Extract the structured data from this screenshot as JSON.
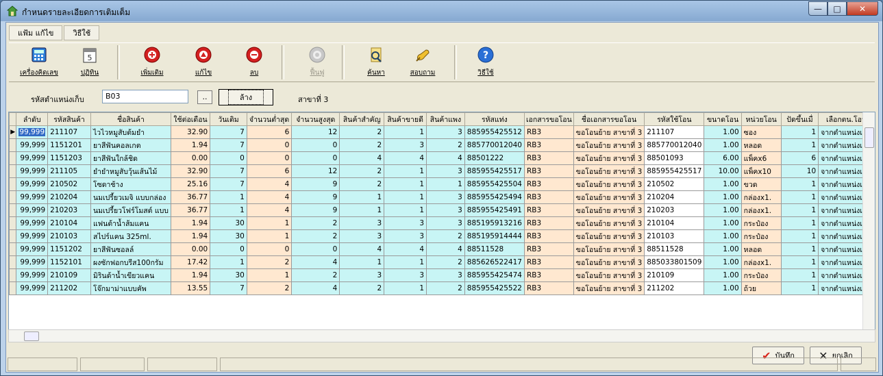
{
  "window": {
    "title": "กำหนดรายละเอียดการเติมเต็ม",
    "minimize_glyph": "—",
    "maximize_glyph": "□",
    "close_glyph": "✕"
  },
  "menu": [
    "แฟ้ม  แก้ไข",
    "วิธีใช้"
  ],
  "toolbar": [
    {
      "label": "เครื่องคิดเลข",
      "icon": "calculator-icon",
      "enabled": true
    },
    {
      "label": "ปฏิทิน",
      "icon": "calendar-icon",
      "enabled": true
    },
    {
      "label": "เพิ่มเติม",
      "icon": "add-icon",
      "enabled": true
    },
    {
      "label": "แก้ไข",
      "icon": "edit-icon",
      "enabled": true
    },
    {
      "label": "ลบ",
      "icon": "delete-icon",
      "enabled": true
    },
    {
      "label": "ฟื้นฟู",
      "icon": "restore-icon",
      "enabled": false
    },
    {
      "label": "ค้นหา",
      "icon": "search-icon",
      "enabled": true
    },
    {
      "label": "สอบถาม",
      "icon": "inquiry-icon",
      "enabled": true
    },
    {
      "label": "วิธีใช้",
      "icon": "help-icon",
      "enabled": true
    }
  ],
  "filter": {
    "label": "รหัสตำแหน่งเก็บ",
    "value": "B03",
    "browse": "..",
    "clear": "ล้าง",
    "branch": "สาขาที่ 3"
  },
  "grid": {
    "columns": [
      "ลำดับ",
      "รหัสสินค้า",
      "ชื่อสินค้า",
      "ใช้ต่อเดือน",
      "วันเติม",
      "จำนวนต่ำสุด",
      "จำนวนสูงสุด",
      "สินค้าสำคัญ",
      "สินค้าขายดี",
      "สินค้าแพง",
      "รหัสแท่ง",
      "เอกสารขอโอน",
      "ชื่อเอกสารขอโอน",
      "รหัสใช้โอน",
      "ขนาดโอน",
      "หน่วยโอน",
      "ปัดขึ้นเมื่",
      "เลือกตน.โอน"
    ],
    "rows": [
      [
        "99,999",
        "211107",
        "ไวไวหมูสับต้มยำ",
        "32.90",
        "7",
        "6",
        "12",
        "2",
        "1",
        "3",
        "885955425512",
        "RB3",
        "ขอโอนย้าย สาขาที่ 3",
        "211107",
        "1.00",
        "ซอง",
        "1",
        "จากตำแหน่งเก็บ"
      ],
      [
        "99,999",
        "1151201",
        "ยาสีฟันคอลเกต",
        "1.94",
        "7",
        "0",
        "0",
        "2",
        "3",
        "2",
        "885770012040",
        "RB3",
        "ขอโอนย้าย สาขาที่ 3",
        "885770012040",
        "1.00",
        "หลอด",
        "1",
        "จากตำแหน่งเก็บ"
      ],
      [
        "99,999",
        "1151203",
        "ยาสีฟันใกล้ชิด",
        "0.00",
        "0",
        "0",
        "0",
        "4",
        "4",
        "4",
        "88501222",
        "RB3",
        "ขอโอนย้าย สาขาที่ 3",
        "88501093",
        "6.00",
        "แพ็คx6",
        "6",
        "จากตำแหน่งเก็บ"
      ],
      [
        "99,999",
        "211105",
        "ยำยำหมูสับวุ้นเส้นไม้",
        "32.90",
        "7",
        "6",
        "12",
        "2",
        "1",
        "3",
        "885955425517",
        "RB3",
        "ขอโอนย้าย สาขาที่ 3",
        "885955425517",
        "10.00",
        "แพ็คx10",
        "10",
        "จากตำแหน่งเก็บ"
      ],
      [
        "99,999",
        "210502",
        "โซดาช้าง",
        "25.16",
        "7",
        "4",
        "9",
        "2",
        "1",
        "1",
        "885955425504",
        "RB3",
        "ขอโอนย้าย สาขาที่ 3",
        "210502",
        "1.00",
        "ขวด",
        "1",
        "จากตำแหน่งเก็บ"
      ],
      [
        "99,999",
        "210204",
        "นมเปรี้ยวเมจิ แบบกล่อง",
        "36.77",
        "1",
        "4",
        "9",
        "1",
        "1",
        "3",
        "885955425494",
        "RB3",
        "ขอโอนย้าย สาขาที่ 3",
        "210204",
        "1.00",
        "กล่องx1.",
        "1",
        "จากตำแหน่งเก็บ"
      ],
      [
        "99,999",
        "210203",
        "นมเปรี้ยวโฟร์โมสต์ แบบ",
        "36.77",
        "1",
        "4",
        "9",
        "1",
        "1",
        "3",
        "885955425491",
        "RB3",
        "ขอโอนย้าย สาขาที่ 3",
        "210203",
        "1.00",
        "กล่องx1.",
        "1",
        "จากตำแหน่งเก็บ"
      ],
      [
        "99,999",
        "210104",
        "แฟนต้าน้ำส้มแคน",
        "1.94",
        "30",
        "1",
        "2",
        "3",
        "3",
        "3",
        "885195913216",
        "RB3",
        "ขอโอนย้าย สาขาที่ 3",
        "210104",
        "1.00",
        "กระป๋อง",
        "1",
        "จากตำแหน่งเก็บ"
      ],
      [
        "99,999",
        "210103",
        "สไปร์แคน 325ml.",
        "1.94",
        "30",
        "1",
        "2",
        "3",
        "3",
        "2",
        "885195914444",
        "RB3",
        "ขอโอนย้าย สาขาที่ 3",
        "210103",
        "1.00",
        "กระป๋อง",
        "1",
        "จากตำแหน่งเก็บ"
      ],
      [
        "99,999",
        "1151202",
        "ยาสีฟันซอลล์",
        "0.00",
        "0",
        "0",
        "0",
        "4",
        "4",
        "4",
        "88511528",
        "RB3",
        "ขอโอนย้าย สาขาที่ 3",
        "88511528",
        "1.00",
        "หลอด",
        "1",
        "จากตำแหน่งเก็บ"
      ],
      [
        "99,999",
        "1152101",
        "ผงซักฟอกบรีส100กรัม",
        "17.42",
        "1",
        "2",
        "4",
        "1",
        "1",
        "2",
        "885626522417",
        "RB3",
        "ขอโอนย้าย สาขาที่ 3",
        "885033801509",
        "1.00",
        "กล่องx1.",
        "1",
        "จากตำแหน่งเก็บ"
      ],
      [
        "99,999",
        "210109",
        "มิรินด้าน้ำเขียวแคน",
        "1.94",
        "30",
        "1",
        "2",
        "3",
        "3",
        "3",
        "885955425474",
        "RB3",
        "ขอโอนย้าย สาขาที่ 3",
        "210109",
        "1.00",
        "กระป๋อง",
        "1",
        "จากตำแหน่งเก็บ"
      ],
      [
        "99,999",
        "211202",
        "โจ๊กมาม่าแบบคัพ",
        "13.55",
        "7",
        "2",
        "4",
        "2",
        "1",
        "2",
        "885955425522",
        "RB3",
        "ขอโอนย้าย สาขาที่ 3",
        "211202",
        "1.00",
        "ถ้วย",
        "1",
        "จากตำแหน่งเก็บ"
      ]
    ]
  },
  "actions": {
    "save": "บันทึก",
    "cancel": "ยกเลิก"
  }
}
